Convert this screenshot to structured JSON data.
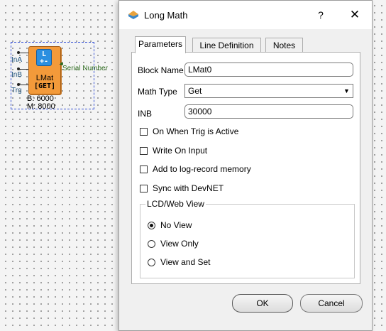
{
  "canvas": {
    "block": {
      "icon_text_top": "L",
      "icon_text_bottom": "+-",
      "name": "LMat",
      "mode": "[GET]",
      "inputs": [
        "InA",
        "InB",
        "Trg"
      ],
      "output_label": "Serial Number",
      "memory_b": "B: 6000",
      "memory_m": "M: 8000"
    }
  },
  "dialog": {
    "title": "Long Math",
    "help_glyph": "?",
    "close_glyph": "✕",
    "tabs": [
      {
        "label": "Parameters",
        "active": true
      },
      {
        "label": "Line Definition",
        "active": false
      },
      {
        "label": "Notes",
        "active": false
      }
    ],
    "fields": {
      "block_name_label": "Block Name",
      "block_name_value": "LMat0",
      "math_type_label": "Math Type",
      "math_type_value": "Get",
      "inb_label": "INB",
      "inb_value": "30000"
    },
    "checkboxes": [
      {
        "label": "On When Trig is Active",
        "checked": false
      },
      {
        "label": "Write On Input",
        "checked": false
      },
      {
        "label": "Add to log-record memory",
        "checked": false
      },
      {
        "label": "Sync with DevNET",
        "checked": false
      }
    ],
    "view_group": {
      "title": "LCD/Web View",
      "options": [
        {
          "label": "No View",
          "selected": true
        },
        {
          "label": "View Only",
          "selected": false
        },
        {
          "label": "View and Set",
          "selected": false
        }
      ]
    },
    "buttons": {
      "ok": "OK",
      "cancel": "Cancel"
    },
    "icon_colors": {
      "top": "#e9a23b",
      "bottom": "#3a86c8"
    }
  }
}
